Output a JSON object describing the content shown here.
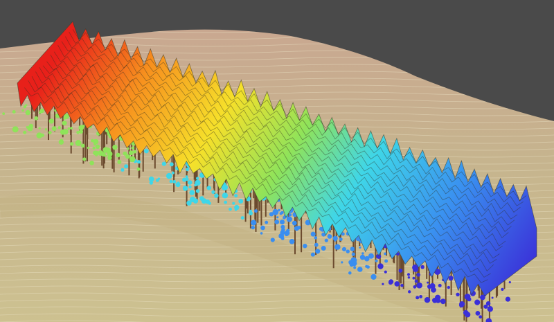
{
  "scene": {
    "colors": {
      "sky": "#4a4a4a",
      "terrain_far": "#c9a890",
      "terrain_mid": "#c2b48a",
      "terrain_near": "#cbbf8e",
      "contour_line": "#e8e0c4",
      "trunk": "#6b4a2e",
      "canopy_outline": "#3a3a2a"
    },
    "height_color_ramp": [
      "#e8201a",
      "#f7901e",
      "#f6e02a",
      "#8fe35a",
      "#3fd6e8",
      "#3a8ef0",
      "#3a2fd8"
    ]
  }
}
